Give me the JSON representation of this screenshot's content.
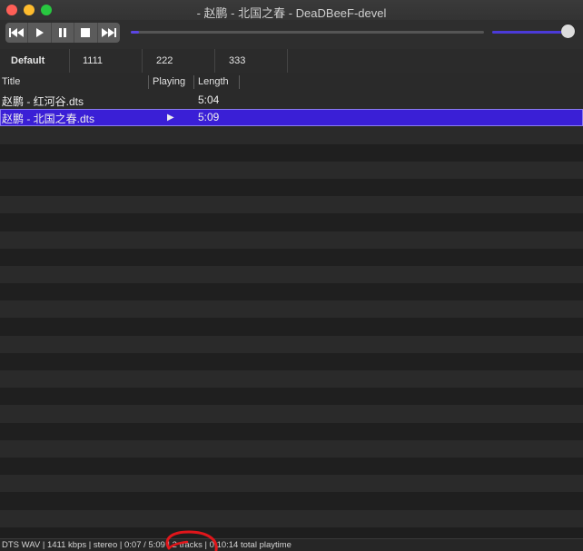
{
  "window": {
    "title": "- 赵鹏 - 北国之春 - DeaDBeeF-devel"
  },
  "toolbar": {
    "buttons": [
      "previous-icon",
      "play-icon",
      "pause-icon",
      "stop-icon",
      "next-icon"
    ],
    "seek_progress": 0.023,
    "volume_level": 1.0,
    "accent": "#5b45e3"
  },
  "tabs": [
    {
      "label": "Default",
      "active": true
    },
    {
      "label": "1111"
    },
    {
      "label": "222"
    },
    {
      "label": "333"
    }
  ],
  "columns": {
    "title": "Title",
    "playing": "Playing",
    "length": "Length"
  },
  "tracks": [
    {
      "title": "赵鹏 - 红河谷.dts",
      "playing": "",
      "length": "5:04"
    },
    {
      "title": "赵鹏 - 北国之春.dts",
      "playing": "▶",
      "length": "5:09",
      "selected": true
    }
  ],
  "status": {
    "text": "DTS WAV | 1411 kbps | stereo | 0:07 / 5:09 | 2 tracks | 0:10:14 total playtime"
  },
  "colors": {
    "selection": "#3a1fd6",
    "annotation": "#e0161b"
  }
}
